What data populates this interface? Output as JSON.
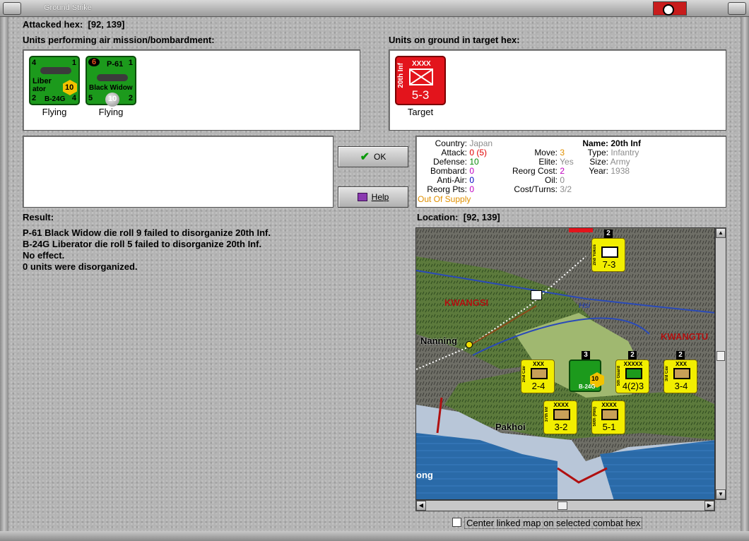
{
  "window": {
    "title": "Ground Strike"
  },
  "attacked_hex": {
    "label": "Attacked hex:",
    "value": "[92, 139]"
  },
  "air_units": {
    "header": "Units performing air mission/bombardment:",
    "items": [
      {
        "top_left": "4",
        "top_right": "1",
        "name_line1": "Liber",
        "name_line2": "ator",
        "model": "B-24G",
        "bottom_left": "2",
        "bottom_right": "4",
        "defense": "10",
        "status": "Flying"
      },
      {
        "top_left": "6",
        "top_mid": "P-61",
        "top_right": "1",
        "name_line1": "Black Widow",
        "model": "",
        "bottom_left": "5",
        "bottom_right": "2",
        "defense": "10",
        "status": "Flying"
      }
    ]
  },
  "ground_units": {
    "header": "Units on ground in target hex:",
    "items": [
      {
        "side": "20th Inf",
        "size": "XXXX",
        "value": "5-3",
        "status": "Target"
      }
    ]
  },
  "buttons": {
    "ok": "OK",
    "help": "Help"
  },
  "stats": {
    "country_k": "Country:",
    "country_v": "Japan",
    "attack_k": "Attack:",
    "attack_v": "0 (5)",
    "defense_k": "Defense:",
    "defense_v": "10",
    "bombard_k": "Bombard:",
    "bombard_v": "0",
    "antiair_k": "Anti-Air:",
    "antiair_v": "0",
    "reorgpts_k": "Reorg Pts:",
    "reorgpts_v": "0",
    "supply": "Out Of Supply",
    "move_k": "Move:",
    "move_v": "3",
    "elite_k": "Elite:",
    "elite_v": "Yes",
    "reorgcost_k": "Reorg Cost:",
    "reorgcost_v": "2",
    "oil_k": "Oil:",
    "oil_v": "0",
    "costturns_k": "Cost/Turns:",
    "costturns_v": "3/2",
    "name_k": "Name:",
    "name_v": "20th Inf",
    "type_k": "Type:",
    "type_v": "Infantry",
    "size_k": "Size:",
    "size_v": "Army",
    "year_k": "Year:",
    "year_v": "1938"
  },
  "result": {
    "label": "Result:",
    "lines": [
      "P-61 Black Widow die roll 9 failed to disorganize 20th Inf.",
      "B-24G Liberator die roll 5 failed to disorganize 20th Inf.",
      "No effect.",
      "0 units were disorganized."
    ]
  },
  "location": {
    "label": "Location:",
    "value": "[92, 139]"
  },
  "map": {
    "regions": [
      "KWANGSI",
      "KWANGTU"
    ],
    "cities": [
      "Nanning",
      "Pakhoi",
      "ong"
    ],
    "river": "Hsi",
    "units": [
      {
        "side": "2nd Yokos",
        "size": "XXX",
        "value": "7-3"
      },
      {
        "side": "2nd Cav",
        "size": "XXX",
        "value": "2-4"
      },
      {
        "side": "5th Guard",
        "size": "XXXXX",
        "value": "4(2)3"
      },
      {
        "side": "3rd Cav",
        "size": "XXX",
        "value": "3-4"
      },
      {
        "side": "37th Inf",
        "size": "XXXX",
        "value": "3-2"
      },
      {
        "side": "50th (Rm)",
        "size": "XXXX",
        "value": "5-1"
      }
    ],
    "stack_counts": [
      "2",
      "3",
      "2",
      "2"
    ],
    "air_counter": {
      "model": "B-24G",
      "defense": "10"
    }
  },
  "checkbox": {
    "label": "Center linked map on selected combat hex"
  }
}
